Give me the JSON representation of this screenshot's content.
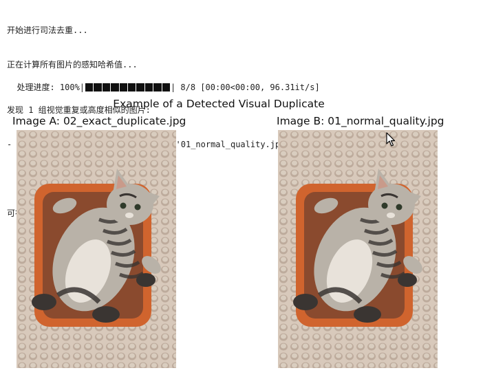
{
  "console": {
    "line1": "开始进行司法去重...",
    "line2": "正在计算所有图片的感知哈希值...",
    "progress": {
      "prefix": "处理进度: 100%|",
      "value": 1.0,
      "suffix": "| 8/8 [00:00<00:00, 96.31it/s]"
    },
    "line4": "发现 1 组视觉重复或高度相似的图片:",
    "line5": "- 文件 '02_exact_duplicate.jpg' 与 '01_normal_quality.jpg' 高度相似, 汉明距离: 0",
    "line6": "",
    "line7": "可视化其中一组:"
  },
  "figure": {
    "title": "Example of a Detected Visual Duplicate",
    "image_a_title": "Image A: 02_exact_duplicate.jpg",
    "image_b_title": "Image B: 01_normal_quality.jpg"
  },
  "colors": {
    "knit_light": "#d8c9bb",
    "knit_dark": "#a89284",
    "basket": "#d0642e",
    "basket_inner": "#8a4a2e",
    "cat_fur": "#b9b2a8",
    "cat_dark": "#3a3532"
  },
  "icons": {
    "cursor": "mouse-pointer-icon"
  }
}
